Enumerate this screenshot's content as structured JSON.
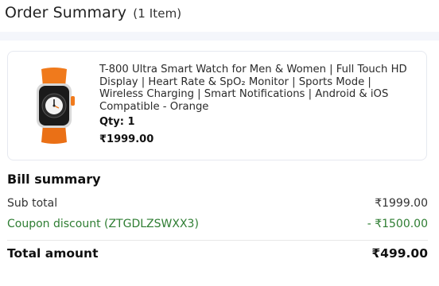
{
  "header": {
    "title": "Order Summary",
    "item_count": "(1 Item)"
  },
  "product": {
    "name": "T-800 Ultra Smart Watch for Men & Women | Full Touch HD Display | Heart Rate & SpO₂ Monitor | Sports Mode | Wireless Charging | Smart Notifications | Android & iOS Compatible - Orange",
    "qty_label": "Qty: 1",
    "price": "₹1999.00",
    "image_icon": "smart-watch-orange"
  },
  "bill": {
    "title": "Bill summary",
    "subtotal_label": "Sub total",
    "subtotal_value": "₹1999.00",
    "coupon_label": "Coupon discount (ZTGDLZSWXX3)",
    "coupon_value": "- ₹1500.00",
    "total_label": "Total amount",
    "total_value": "₹499.00"
  },
  "colors": {
    "coupon_green": "#2e7d32",
    "band": "#f4f6fb",
    "strap_orange": "#f07a1c"
  }
}
